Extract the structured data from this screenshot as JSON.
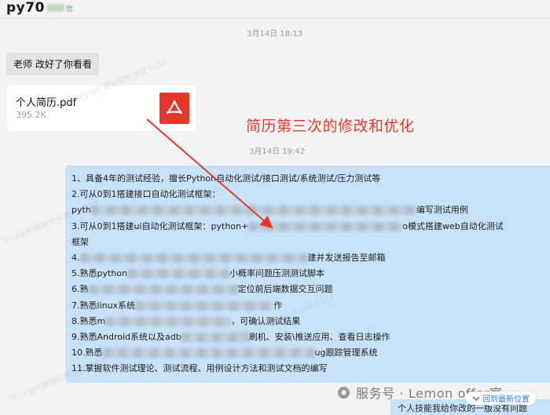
{
  "header": {
    "title": "py70",
    "subtitle": "信"
  },
  "timestamps": [
    "3月14日 18:13",
    "3月14日 19:42"
  ],
  "messages": {
    "teacher_note": "老师 改好了你看看",
    "file": {
      "name": "个人简历.pdf",
      "size": "395.2K",
      "icon": "pdf-icon"
    }
  },
  "annotation": "简历第三次的修改和优化",
  "resume_lines": [
    {
      "pre": "1、具备4年的测试经验，擅长Python自动化测试/接口测试/系统测试/压力测试等",
      "post": ""
    },
    {
      "pre": "2.可从0到1搭建接口自动化测试框架：",
      "post": ""
    },
    {
      "pre": "pyth",
      "post": "编写测试用例"
    },
    {
      "pre": "3.可从0到1搭建ui自动化测试框架：python+",
      "post": "o模式搭建web自动化测试"
    },
    {
      "pre": "框架",
      "post": ""
    },
    {
      "pre": "4.",
      "post": "建并发送报告至邮箱"
    },
    {
      "pre": "5.熟悉python",
      "post": "小概率问题压测测试脚本"
    },
    {
      "pre": "6.熟",
      "post": "定位前后端数据交互问题"
    },
    {
      "pre": "7.熟悉linux系统",
      "post": "作"
    },
    {
      "pre": "8.熟悉m",
      "post": "，可确认测试结果"
    },
    {
      "pre": "9.熟悉Android系统以及adb",
      "post": "刷机、安装\\推送应用、查看日志操作"
    },
    {
      "pre": "10.熟悉",
      "post": "ug跟踪管理系统"
    },
    {
      "pre": "11.掌握软件测试理论、测试流程、用例设计方法和测试文档的编写",
      "post": ""
    }
  ],
  "watermark": "Tricy@柠檬班软件测试 0107",
  "footer": {
    "brand": "服务号 · Lemon offer官"
  },
  "bottom_bubble": "个人技能我给你改的一版没有问题",
  "new_message_button": "回到最新位置",
  "colors": {
    "accent_red": "#e8382d",
    "bubble_blue": "#c8e3f9",
    "pdf_red": "#e5362b"
  }
}
